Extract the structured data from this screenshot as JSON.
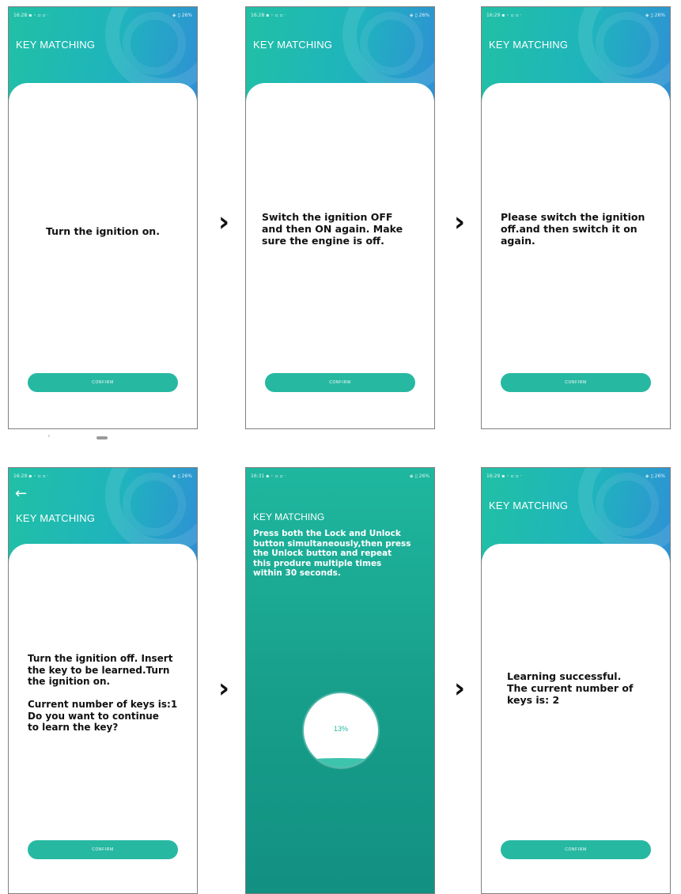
{
  "screens": [
    {
      "status_time": "16:28 ▪ ◦ ▫ ▫ ·",
      "status_right": "◈ ▯ 26%",
      "title": "KEY MATCHING",
      "message": "Turn the ignition on.",
      "confirm": "CONFIRM"
    },
    {
      "status_time": "16:28 ▪ ◦ ▫ ▫ ·",
      "status_right": "◈ ▯ 26%",
      "title": "KEY MATCHING",
      "message": "Switch the ignition OFF\nand then ON again. Make\nsure the engine is off.",
      "confirm": "CONFIRM"
    },
    {
      "status_time": "16:29 ▪ ◦ ▫ ▫ ·",
      "status_right": "◈ ▯ 26%",
      "title": "KEY MATCHING",
      "message": "Please switch the ignition\noff.and then switch it on\nagain.",
      "confirm": "CONFIRM"
    },
    {
      "status_time": "16:29 ▪ ◦ ▫ ▫ ·",
      "status_right": "◈ ▯ 26%",
      "back": "←",
      "title": "KEY MATCHING",
      "message": "Turn the ignition off. Insert\nthe key to be learned.Turn\nthe ignition on.\n\nCurrent number of keys is:1\nDo you want to continue\nto learn the key?",
      "confirm": "CONFIRM"
    },
    {
      "status_time": "16:31 ▪ ◦ ▫ ▫ ·",
      "status_right": "◈ ▯ 26%",
      "title": "KEY MATCHING",
      "message": "Press both the Lock and Unlock\nbutton simultaneously,then press\nthe Unlock button and repeat\nthis produre multiple times\nwithin 30 seconds.",
      "progress": 0.13,
      "progress_label": "13%"
    },
    {
      "status_time": "16:29 ▪ ◦ ▫ ▫ ·",
      "status_right": "◈ ▯ 26%",
      "title": "KEY MATCHING",
      "message": "Learning successful.\nThe current number of\nkeys is: 2",
      "confirm": "CONFIRM"
    }
  ],
  "arrows": [
    "›",
    "›",
    "›",
    "›"
  ],
  "navbar": {
    "back": "‹"
  },
  "colors": {
    "accent": "#27b8a2",
    "header_end": "#2f8fd6"
  }
}
